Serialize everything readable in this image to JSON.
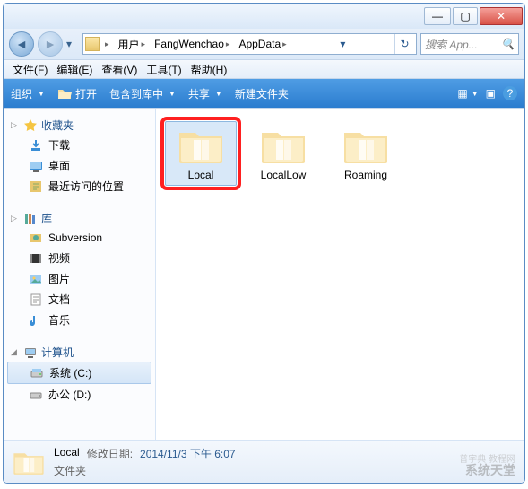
{
  "titlebar": {
    "min": "—",
    "max": "▢",
    "close": "✕"
  },
  "breadcrumb": {
    "items": [
      "用户",
      "FangWenchao",
      "AppData"
    ]
  },
  "search": {
    "placeholder": "搜索 App..."
  },
  "menubar": {
    "file": "文件(F)",
    "edit": "编辑(E)",
    "view": "查看(V)",
    "tools": "工具(T)",
    "help": "帮助(H)"
  },
  "toolbar": {
    "organize": "组织",
    "open": "打开",
    "library": "包含到库中",
    "share": "共享",
    "newfolder": "新建文件夹"
  },
  "sidebar": {
    "favorites": {
      "label": "收藏夹",
      "items": [
        {
          "label": "下载"
        },
        {
          "label": "桌面"
        },
        {
          "label": "最近访问的位置"
        }
      ]
    },
    "libraries": {
      "label": "库",
      "items": [
        {
          "label": "Subversion"
        },
        {
          "label": "视频"
        },
        {
          "label": "图片"
        },
        {
          "label": "文档"
        },
        {
          "label": "音乐"
        }
      ]
    },
    "computer": {
      "label": "计算机",
      "items": [
        {
          "label": "系统 (C:)",
          "selected": true
        },
        {
          "label": "办公 (D:)"
        }
      ]
    }
  },
  "folders": [
    {
      "name": "Local",
      "selected": true,
      "highlighted": true
    },
    {
      "name": "LocalLow"
    },
    {
      "name": "Roaming"
    }
  ],
  "status": {
    "name": "Local",
    "date_label": "修改日期:",
    "date_value": "2014/11/3 下午 6:07",
    "type": "文件夹"
  },
  "watermark": {
    "line1": "系统天堂",
    "line2": "普字典 教程网"
  }
}
